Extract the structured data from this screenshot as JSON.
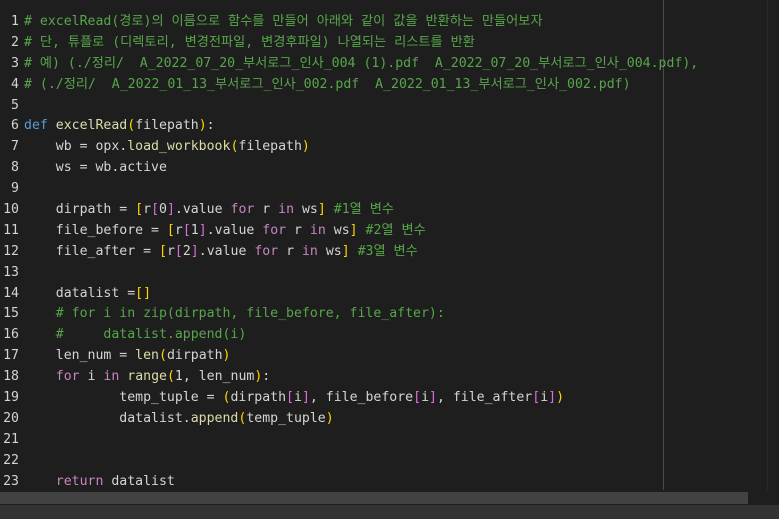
{
  "editor": {
    "lines": [
      {
        "n": "1",
        "segs": [
          {
            "t": "# excelRead(경로)의 이름으로 함수를 만들어 아래와 같이 값을 반환하는 만들어보자",
            "c": "cm"
          }
        ]
      },
      {
        "n": "2",
        "segs": [
          {
            "t": "# 단, 튜플로 (디렉토리, 변경전파일, 변경후파일) 나열되는 리스트를 반환",
            "c": "cm"
          }
        ]
      },
      {
        "n": "3",
        "segs": [
          {
            "t": "# 예) (./정리/  A_2022_07_20_부서로그_인사_004 (1).pdf  A_2022_07_20_부서로그_인사_004.pdf),",
            "c": "cm"
          }
        ]
      },
      {
        "n": "4",
        "segs": [
          {
            "t": "# (./정리/  A_2022_01_13_부서로그_인사_002.pdf  A_2022_01_13_부서로그_인사_002.pdf)",
            "c": "cm"
          }
        ]
      },
      {
        "n": "5",
        "segs": []
      },
      {
        "n": "6",
        "segs": [
          {
            "t": "def ",
            "c": "kw"
          },
          {
            "t": "excelRead",
            "c": "fn"
          },
          {
            "t": "(",
            "c": "br1"
          },
          {
            "t": "filepath",
            "c": "plain"
          },
          {
            "t": ")",
            "c": "br1"
          },
          {
            "t": ":",
            "c": "plain"
          }
        ]
      },
      {
        "n": "7",
        "segs": [
          {
            "t": "    wb = opx.",
            "c": "plain"
          },
          {
            "t": "load_workbook",
            "c": "fn"
          },
          {
            "t": "(",
            "c": "br1"
          },
          {
            "t": "filepath",
            "c": "plain"
          },
          {
            "t": ")",
            "c": "br1"
          }
        ]
      },
      {
        "n": "8",
        "segs": [
          {
            "t": "    ws = wb.active",
            "c": "plain"
          }
        ]
      },
      {
        "n": "9",
        "segs": []
      },
      {
        "n": "10",
        "segs": [
          {
            "t": "    dirpath = ",
            "c": "plain"
          },
          {
            "t": "[",
            "c": "br1"
          },
          {
            "t": "r",
            "c": "plain"
          },
          {
            "t": "[",
            "c": "br2"
          },
          {
            "t": "0",
            "c": "plain"
          },
          {
            "t": "]",
            "c": "br2"
          },
          {
            "t": ".value ",
            "c": "plain"
          },
          {
            "t": "for",
            "c": "kw2"
          },
          {
            "t": " r ",
            "c": "plain"
          },
          {
            "t": "in",
            "c": "kw2"
          },
          {
            "t": " ws",
            "c": "plain"
          },
          {
            "t": "]",
            "c": "br1"
          },
          {
            "t": " #1열 변수",
            "c": "cm"
          }
        ]
      },
      {
        "n": "11",
        "segs": [
          {
            "t": "    file_before = ",
            "c": "plain"
          },
          {
            "t": "[",
            "c": "br1"
          },
          {
            "t": "r",
            "c": "plain"
          },
          {
            "t": "[",
            "c": "br2"
          },
          {
            "t": "1",
            "c": "plain"
          },
          {
            "t": "]",
            "c": "br2"
          },
          {
            "t": ".value ",
            "c": "plain"
          },
          {
            "t": "for",
            "c": "kw2"
          },
          {
            "t": " r ",
            "c": "plain"
          },
          {
            "t": "in",
            "c": "kw2"
          },
          {
            "t": " ws",
            "c": "plain"
          },
          {
            "t": "]",
            "c": "br1"
          },
          {
            "t": " #2열 변수",
            "c": "cm"
          }
        ]
      },
      {
        "n": "12",
        "segs": [
          {
            "t": "    file_after = ",
            "c": "plain"
          },
          {
            "t": "[",
            "c": "br1"
          },
          {
            "t": "r",
            "c": "plain"
          },
          {
            "t": "[",
            "c": "br2"
          },
          {
            "t": "2",
            "c": "plain"
          },
          {
            "t": "]",
            "c": "br2"
          },
          {
            "t": ".value ",
            "c": "plain"
          },
          {
            "t": "for",
            "c": "kw2"
          },
          {
            "t": " r ",
            "c": "plain"
          },
          {
            "t": "in",
            "c": "kw2"
          },
          {
            "t": " ws",
            "c": "plain"
          },
          {
            "t": "]",
            "c": "br1"
          },
          {
            "t": " #3열 변수",
            "c": "cm"
          }
        ]
      },
      {
        "n": "13",
        "segs": []
      },
      {
        "n": "14",
        "segs": [
          {
            "t": "    datalist =",
            "c": "plain"
          },
          {
            "t": "[]",
            "c": "br1"
          }
        ]
      },
      {
        "n": "15",
        "segs": [
          {
            "t": "    # for i in zip(dirpath, file_before, file_after):",
            "c": "cm"
          }
        ]
      },
      {
        "n": "16",
        "segs": [
          {
            "t": "    #     datalist.append(i)",
            "c": "cm"
          }
        ]
      },
      {
        "n": "17",
        "segs": [
          {
            "t": "    len_num = ",
            "c": "plain"
          },
          {
            "t": "len",
            "c": "fn"
          },
          {
            "t": "(",
            "c": "br1"
          },
          {
            "t": "dirpath",
            "c": "plain"
          },
          {
            "t": ")",
            "c": "br1"
          }
        ]
      },
      {
        "n": "18",
        "segs": [
          {
            "t": "    ",
            "c": "plain"
          },
          {
            "t": "for",
            "c": "kw2"
          },
          {
            "t": " i ",
            "c": "plain"
          },
          {
            "t": "in",
            "c": "kw2"
          },
          {
            "t": " ",
            "c": "plain"
          },
          {
            "t": "range",
            "c": "fn"
          },
          {
            "t": "(",
            "c": "br1"
          },
          {
            "t": "1, len_num",
            "c": "plain"
          },
          {
            "t": ")",
            "c": "br1"
          },
          {
            "t": ":",
            "c": "plain"
          }
        ]
      },
      {
        "n": "19",
        "segs": [
          {
            "t": "            temp_tuple = ",
            "c": "plain"
          },
          {
            "t": "(",
            "c": "br1"
          },
          {
            "t": "dirpath",
            "c": "plain"
          },
          {
            "t": "[",
            "c": "br2"
          },
          {
            "t": "i",
            "c": "plain"
          },
          {
            "t": "]",
            "c": "br2"
          },
          {
            "t": ", file_before",
            "c": "plain"
          },
          {
            "t": "[",
            "c": "br2"
          },
          {
            "t": "i",
            "c": "plain"
          },
          {
            "t": "]",
            "c": "br2"
          },
          {
            "t": ", file_after",
            "c": "plain"
          },
          {
            "t": "[",
            "c": "br2"
          },
          {
            "t": "i",
            "c": "plain"
          },
          {
            "t": "]",
            "c": "br2"
          },
          {
            "t": ")",
            "c": "br1"
          }
        ]
      },
      {
        "n": "20",
        "segs": [
          {
            "t": "            datalist.",
            "c": "plain"
          },
          {
            "t": "append",
            "c": "fn"
          },
          {
            "t": "(",
            "c": "br1"
          },
          {
            "t": "temp_tuple",
            "c": "plain"
          },
          {
            "t": ")",
            "c": "br1"
          }
        ]
      },
      {
        "n": "21",
        "segs": []
      },
      {
        "n": "22",
        "segs": []
      },
      {
        "n": "23",
        "segs": [
          {
            "t": "    ",
            "c": "plain"
          },
          {
            "t": "return",
            "c": "kw2"
          },
          {
            "t": " datalist",
            "c": "plain"
          }
        ]
      }
    ]
  },
  "colors": {
    "background": "#1e1e1e",
    "comment": "#57a64a",
    "keyword_def": "#569cd6",
    "keyword_control": "#c586c0",
    "function": "#dcdcaa",
    "text": "#d4d4d4"
  }
}
